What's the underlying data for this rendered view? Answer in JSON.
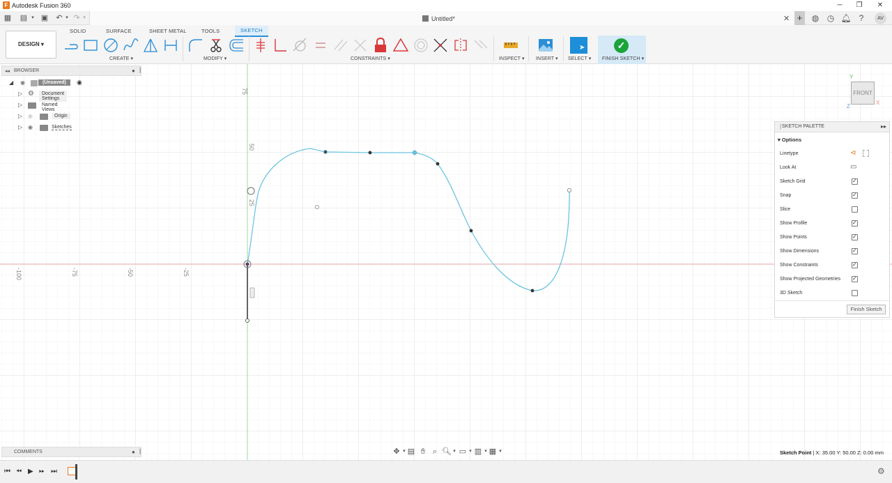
{
  "app": {
    "title": "Autodesk Fusion 360",
    "icon_letter": "F"
  },
  "document": {
    "title": "Untitled*"
  },
  "user": {
    "initials": "AV"
  },
  "toolbar": {
    "workspace": "DESIGN",
    "tabs": [
      {
        "label": "SOLID"
      },
      {
        "label": "SURFACE"
      },
      {
        "label": "SHEET METAL"
      },
      {
        "label": "TOOLS"
      },
      {
        "label": "SKETCH"
      }
    ],
    "active_tab": "SKETCH",
    "groups": {
      "create": "CREATE ▾",
      "modify": "MODIFY ▾",
      "constraints": "CONSTRAINTS ▾",
      "inspect": "INSPECT ▾",
      "insert": "INSERT ▾",
      "select": "SELECT ▾",
      "finish": "FINISH SKETCH ▾"
    },
    "accent_color": "#2b8fd6",
    "finish_color": "#1aa43b",
    "constraint_lock_color": "#d9383a"
  },
  "browser": {
    "title": "BROWSER",
    "root": "(Unsaved)",
    "items": [
      {
        "label": "Document Settings"
      },
      {
        "label": "Named Views"
      },
      {
        "label": "Origin"
      },
      {
        "label": "Sketches"
      }
    ]
  },
  "comments": {
    "title": "COMMENTS"
  },
  "canvas": {
    "axis_labels": {
      "x": [
        "-100",
        "-75",
        "-50",
        "-25"
      ],
      "y": [
        "75",
        "50",
        "25"
      ]
    },
    "curve_color": "#6cc4e0",
    "x_axis_color": "#e58a8a",
    "y_axis_color": "#8fd08f"
  },
  "viewcube": {
    "face": "FRONT",
    "axis_y": "Y",
    "axis_x": "X",
    "axis_z": "Z"
  },
  "palette": {
    "title": "SKETCH PALETTE",
    "section": "Options",
    "rows": [
      {
        "label": "Linetype",
        "kind": "icons"
      },
      {
        "label": "Look At",
        "kind": "icon"
      },
      {
        "label": "Sketch Grid",
        "checked": true
      },
      {
        "label": "Snap",
        "checked": true
      },
      {
        "label": "Slice",
        "checked": false
      },
      {
        "label": "Show Profile",
        "checked": true
      },
      {
        "label": "Show Points",
        "checked": true
      },
      {
        "label": "Show Dimensions",
        "checked": true
      },
      {
        "label": "Show Constraints",
        "checked": true
      },
      {
        "label": "Show Projected Geometries",
        "checked": true
      },
      {
        "label": "3D Sketch",
        "checked": false
      }
    ],
    "finish_button": "Finish Sketch"
  },
  "status": {
    "label": "Sketch Point",
    "coords": " | X: 35.00 Y: 50.00 Z: 0.00 mm"
  }
}
